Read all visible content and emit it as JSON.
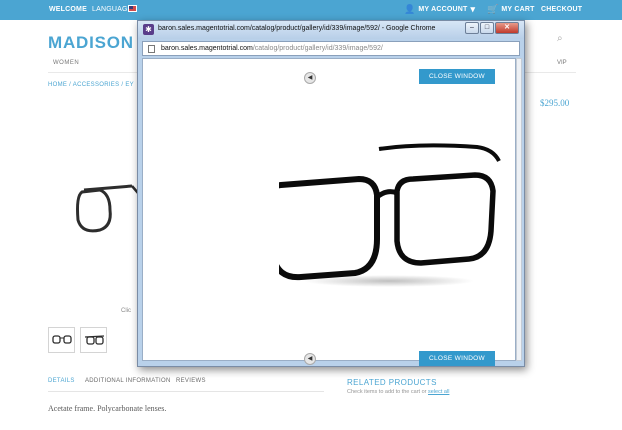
{
  "header": {
    "welcome": "WELCOME",
    "language": "LANGUAGE",
    "my_account": "MY ACCOUNT",
    "my_cart": "MY CART",
    "checkout": "CHECKOUT"
  },
  "store": {
    "logo_text": "MADISON ISL",
    "nav_women": "WOMEN",
    "nav_vip": "VIP",
    "breadcrumb": "HOME / ACCESSORIES / EY",
    "price": "$295.00",
    "gallery_hint_fragment": "Clic",
    "tabs": {
      "details": "DETAILS",
      "additional_information": "ADDITIONAL INFORMATION",
      "reviews": "REVIEWS"
    },
    "description": "Acetate frame. Polycarbonate lenses.",
    "related_heading": "RELATED PRODUCTS",
    "related_text": "Check items to add to the cart or",
    "related_select_all": "select all"
  },
  "popup": {
    "window_title": "baron.sales.magentotrial.com/catalog/product/gallery/id/339/image/592/ - Google Chrome",
    "url_host": "baron.sales.magentotrial.com",
    "url_path": "/catalog/product/gallery/id/339/image/592/",
    "close_window_label": "CLOSE WINDOW",
    "prev_glyph": "◀"
  },
  "colors": {
    "accent": "#3399cc",
    "window_frame": "#b9d1ea",
    "close_button": "#c0392b"
  }
}
